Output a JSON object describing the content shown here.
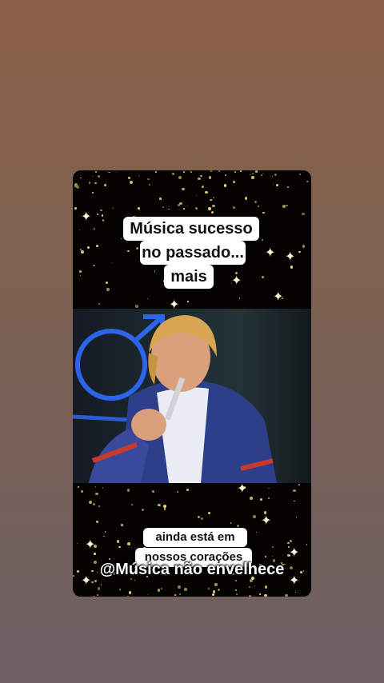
{
  "story": {
    "top_caption_lines": [
      "Música sucesso",
      "no passado...",
      "mais"
    ],
    "bottom_caption_lines": [
      "ainda está em",
      "nossos corações"
    ],
    "watermark": "@Música não envelhece"
  },
  "video": {
    "description_icon": "male-symbol-icon"
  },
  "colors": {
    "background_top": "#8a6048",
    "background_bottom": "#6d5f63",
    "sparkle": "#f3d37a",
    "caption_bg": "#ffffff"
  }
}
